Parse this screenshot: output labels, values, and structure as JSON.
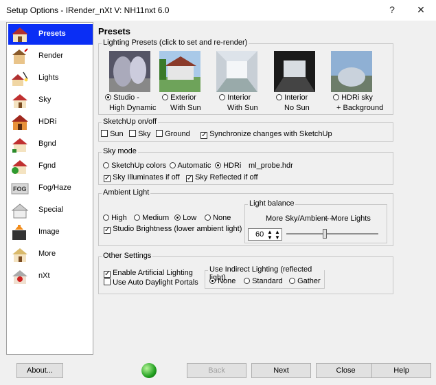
{
  "window": {
    "title": "Setup Options - IRender_nXt V: NH11nxt 6.0",
    "help_label": "?",
    "close_label": "✕"
  },
  "sidebar": {
    "items": [
      {
        "label": "Presets",
        "icon": "house-icon",
        "selected": true
      },
      {
        "label": "Render",
        "icon": "render-icon"
      },
      {
        "label": "Lights",
        "icon": "lamp-icon"
      },
      {
        "label": "Sky",
        "icon": "sky-house-icon"
      },
      {
        "label": "HDRi",
        "icon": "hdri-icon"
      },
      {
        "label": "Bgnd",
        "icon": "background-icon"
      },
      {
        "label": "Fgnd",
        "icon": "foreground-icon"
      },
      {
        "label": "Fog/Haze",
        "icon": "fog-icon"
      },
      {
        "label": "Special",
        "icon": "special-icon"
      },
      {
        "label": "Image",
        "icon": "save-image-icon"
      },
      {
        "label": "More",
        "icon": "more-icon"
      },
      {
        "label": "nXt",
        "icon": "nxt-icon"
      }
    ]
  },
  "page_title": "Presets",
  "lighting_presets": {
    "label": "Lighting Presets (click to set and re-render)",
    "options": [
      {
        "line1": "Studio -",
        "line2": "High Dynamic",
        "selected": true
      },
      {
        "line1": "Exterior",
        "line2": "With Sun"
      },
      {
        "line1": "Interior",
        "line2": "With Sun"
      },
      {
        "line1": "Interior",
        "line2": "No Sun"
      },
      {
        "line1": "HDRi sky",
        "line2": "+ Background"
      }
    ]
  },
  "sketchup": {
    "label": "SketchUp on/off",
    "sun": "Sun",
    "sky": "Sky",
    "ground": "Ground",
    "sync": "Synchronize changes with SketchUp"
  },
  "sky_mode": {
    "label": "Sky mode",
    "sketchup_colors": "SketchUp colors",
    "automatic": "Automatic",
    "hdri": "HDRi",
    "hdri_file": "ml_probe.hdr",
    "sky_illuminates": "Sky Illuminates if off",
    "sky_reflected": "Sky Reflected if off"
  },
  "ambient": {
    "label": "Ambient Light",
    "high": "High",
    "medium": "Medium",
    "low": "Low",
    "none": "None",
    "studio_brightness": "Studio Brightness (lower ambient light)"
  },
  "light_balance": {
    "label": "Light balance",
    "left_text": "More Sky/Ambient --",
    "right_text": "-- More Lights",
    "value": "60"
  },
  "other": {
    "label": "Other Settings",
    "artificial": "Enable Artificial Lighting",
    "daylight_portals": "Use Auto Daylight Portals",
    "indirect_label": "Use Indirect Lighting (reflected light)",
    "none": "None",
    "standard": "Standard",
    "gather": "Gather"
  },
  "buttons": {
    "about": "About...",
    "back": "Back",
    "next": "Next",
    "close": "Close",
    "help": "Help"
  }
}
